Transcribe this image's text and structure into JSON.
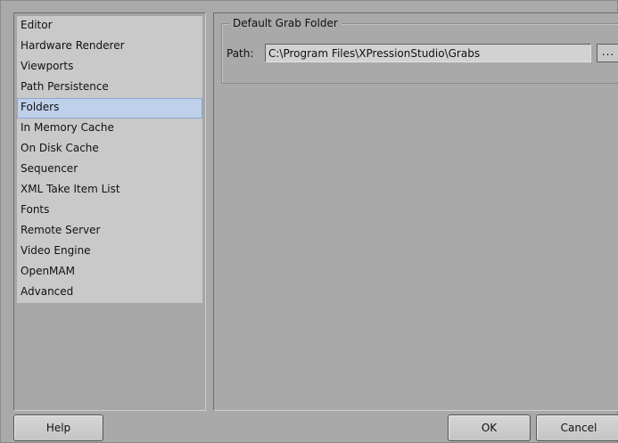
{
  "categories": [
    {
      "label": "Editor",
      "selected": false
    },
    {
      "label": "Hardware Renderer",
      "selected": false
    },
    {
      "label": "Viewports",
      "selected": false
    },
    {
      "label": "Path Persistence",
      "selected": false
    },
    {
      "label": "Folders",
      "selected": true
    },
    {
      "label": "In Memory Cache",
      "selected": false
    },
    {
      "label": "On Disk Cache",
      "selected": false
    },
    {
      "label": "Sequencer",
      "selected": false
    },
    {
      "label": "XML Take Item List",
      "selected": false
    },
    {
      "label": "Fonts",
      "selected": false
    },
    {
      "label": "Remote Server",
      "selected": false
    },
    {
      "label": "Video Engine",
      "selected": false
    },
    {
      "label": "OpenMAM",
      "selected": false
    },
    {
      "label": "Advanced",
      "selected": false
    }
  ],
  "folders": {
    "group_title": "Default Grab Folder",
    "path_label": "Path:",
    "path_value": "C:\\Program Files\\XPressionStudio\\Grabs",
    "browse_label": "..."
  },
  "buttons": {
    "help": {
      "mnemonic": "H",
      "rest": "elp"
    },
    "ok": {
      "mnemonic": "O",
      "rest": "K"
    },
    "cancel": {
      "mnemonic": "C",
      "rest": "ancel"
    }
  },
  "colors": {
    "selection": "#bfd0ea",
    "panel_bg": "#a9a9a9",
    "list_bg": "#c9c9c9"
  }
}
